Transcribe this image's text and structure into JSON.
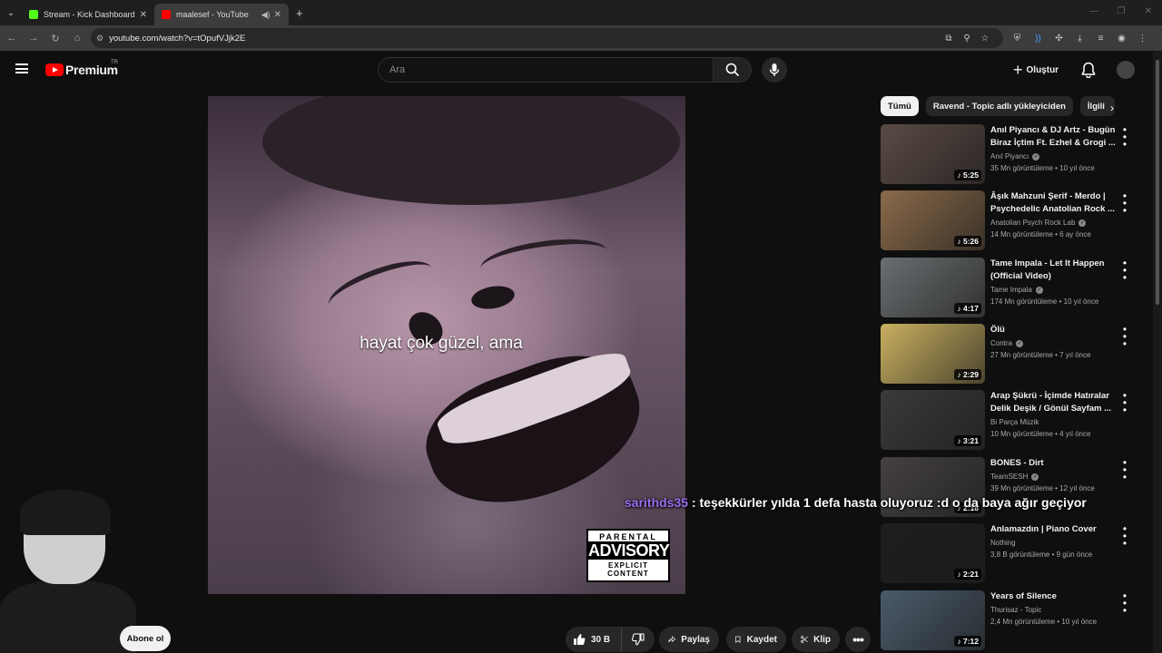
{
  "browser": {
    "tabs": [
      {
        "title": "Stream - Kick Dashboard",
        "color": "#53fc18"
      },
      {
        "title": "maalesef - YouTube",
        "color": "#ff0000"
      }
    ],
    "url": "youtube.com/watch?v=tOpufVJjk2E"
  },
  "header": {
    "logo": "Premium",
    "country": "TR",
    "search_placeholder": "Ara",
    "create_label": "Oluştur"
  },
  "video": {
    "subtitle": "hayat çok güzel, ama",
    "advisory": {
      "line1": "PARENTAL",
      "line2": "ADVISORY",
      "line3": "EXPLICIT CONTENT"
    }
  },
  "actions": {
    "subscribe": "Abone ol",
    "likes": "30 B",
    "share": "Paylaş",
    "save": "Kaydet",
    "clip": "Klip"
  },
  "chat_overlay": {
    "user": "sarithds35",
    "message": ": teşekkürler yılda 1 defa hasta oluyoruz :d o da baya ağır geçiyor"
  },
  "chips": [
    "Tümü",
    "Ravend - Topic adlı yükleyiciden",
    "İlgili"
  ],
  "recommendations": [
    {
      "title": "Anıl Piyancı & DJ Artz - Bugün Biraz İçtim Ft. Ezhel & Grogi ...",
      "channel": "Anıl Piyancı",
      "verified": true,
      "meta": "35 Mn görüntüleme • 10 yıl önce",
      "duration": "5:25",
      "thumb": "#5a4a44"
    },
    {
      "title": "Âşık Mahzuni Şerif - Merdo | Psychedelic Anatolian Rock ...",
      "channel": "Anatolian Psych Rock Lab",
      "verified": true,
      "meta": "14 Mn görüntüleme • 6 ay önce",
      "duration": "5:26",
      "thumb": "#8a6a4a"
    },
    {
      "title": "Tame Impala - Let It Happen (Official Video)",
      "channel": "Tame Impala",
      "verified": true,
      "meta": "174 Mn görüntüleme • 10 yıl önce",
      "duration": "4:17",
      "thumb": "#6a6e70"
    },
    {
      "title": "Ölü",
      "channel": "Contra",
      "verified": true,
      "meta": "27 Mn görüntüleme • 7 yıl önce",
      "duration": "2:29",
      "thumb": "#c9b060"
    },
    {
      "title": "Arap Şükrü - İçimde Hatıralar Delik Deşik / Gönül Sayfam ...",
      "channel": "Bi Parça Müzik",
      "verified": false,
      "meta": "10 Mn görüntüleme • 4 yıl önce",
      "duration": "3:21",
      "thumb": "#3a3a3a"
    },
    {
      "title": "BONES - Dirt",
      "channel": "TeamSESH",
      "verified": true,
      "meta": "39 Mn görüntüleme • 12 yıl önce",
      "duration": "2:18",
      "thumb": "#444044"
    },
    {
      "title": "Anlamazdın | Piano Cover",
      "channel": "Nothing",
      "verified": false,
      "meta": "3,8 B görüntüleme • 9 gün önce",
      "duration": "2:21",
      "thumb": "#1e1e1e"
    },
    {
      "title": "Years of Silence",
      "channel": "Thurisaz - Topic",
      "verified": false,
      "meta": "2,4 Mn görüntüleme • 10 yıl önce",
      "duration": "7:12",
      "thumb": "#4a5a6a"
    }
  ]
}
